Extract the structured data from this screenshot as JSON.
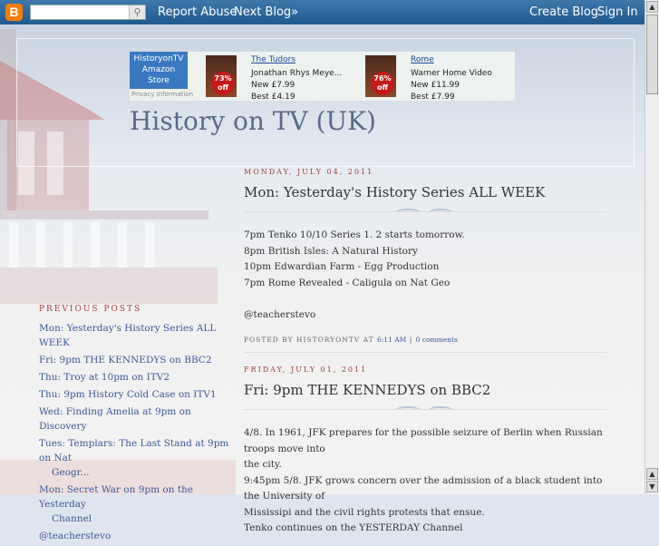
{
  "navbar": {
    "report_abuse": "Report Abuse",
    "next_blog": "Next Blog»",
    "create_blog": "Create Blog",
    "sign_in": "Sign In",
    "logo_letter": "B"
  },
  "ad": {
    "store_line1": "HistoryonTV",
    "store_line2": "Amazon",
    "store_line3": "Store",
    "privacy": "Privacy Information",
    "products": [
      {
        "title": "The Tudors",
        "line1": "Jonathan Rhys Meye...",
        "line2": "New £7.99",
        "line3": "Best £4.19",
        "discount": "73%",
        "off": "off"
      },
      {
        "title": "Rome",
        "line1": "Warner Home Video",
        "line2": "New £11.99",
        "line3": "Best £7.99",
        "discount": "76%",
        "off": "off"
      }
    ]
  },
  "blog_title": "History on TV (UK)",
  "sidebar": {
    "heading": "PREVIOUS POSTS",
    "items": [
      {
        "label": "Mon: Yesterday's History Series ALL WEEK"
      },
      {
        "label": "Fri: 9pm THE KENNEDYS on BBC2"
      },
      {
        "label": "Thu: Troy at 10pm on ITV2"
      },
      {
        "label": "Thu: 9pm History Cold Case on ITV1"
      },
      {
        "label": "Wed: Finding Amelia at 9pm on Discovery"
      },
      {
        "label": "Tues: Templars: The Last Stand at 9pm on Nat",
        "label2": "Geogr..."
      },
      {
        "label": "Mon: Secret War on 9pm on the Yesterday",
        "label2": "Channel"
      },
      {
        "label": "@teacherstevo"
      }
    ]
  },
  "posts": [
    {
      "date": "MONDAY, JULY 04, 2011",
      "title": "Mon: Yesterday's History Series ALL WEEK",
      "lines": [
        "7pm Tenko 10/10 Series 1. 2 starts tomorrow.",
        "8pm British Isles: A Natural History",
        "10pm Edwardian Farm - Egg Production",
        "7pm Rome Revealed - Caligula on Nat Geo",
        "",
        "@teacherstevo"
      ],
      "posted_by": "POSTED BY HISTORYONTV AT",
      "time": "6:11 AM",
      "sep": "|",
      "comments": "0 comments"
    },
    {
      "date": "FRIDAY, JULY 01, 2011",
      "title": "Fri: 9pm THE KENNEDYS on BBC2",
      "lines": [
        "4/8. In 1961, JFK prepares for the possible seizure of Berlin when Russian troops move into",
        "the city.",
        "9:45pm 5/8. JFK grows concern over the admission of a black student into the University of",
        "Mississipi and the civil rights protests that ensue.",
        "Tenko continues on the YESTERDAY Channel"
      ]
    }
  ]
}
